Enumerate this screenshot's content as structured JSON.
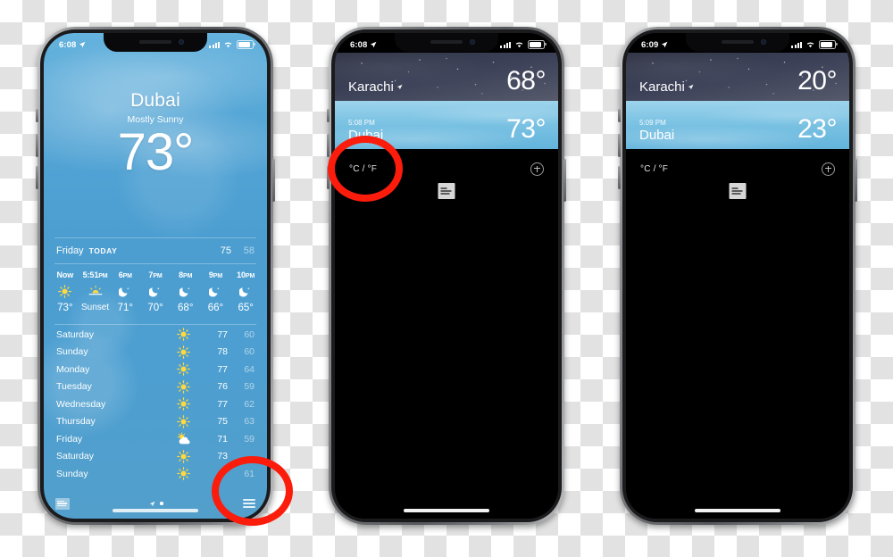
{
  "phone1": {
    "status": {
      "time": "6:08",
      "location_icon": "location-arrow-icon",
      "signal_icon": "signal-bars-icon",
      "wifi_icon": "wifi-icon",
      "battery_icon": "battery-icon"
    },
    "detail": {
      "city": "Dubai",
      "condition": "Mostly Sunny",
      "temperature": "73°"
    },
    "today": {
      "day": "Friday",
      "tag": "TODAY",
      "high": "75",
      "low": "58"
    },
    "hourly": [
      {
        "label": "Now",
        "ampm": "",
        "icon": "sun-icon",
        "value": "73°"
      },
      {
        "label": "5:51",
        "ampm": "PM",
        "icon": "sunset-icon",
        "value": "Sunset"
      },
      {
        "label": "6",
        "ampm": "PM",
        "icon": "moon-icon",
        "value": "71°"
      },
      {
        "label": "7",
        "ampm": "PM",
        "icon": "moon-icon",
        "value": "70°"
      },
      {
        "label": "8",
        "ampm": "PM",
        "icon": "moon-icon",
        "value": "68°"
      },
      {
        "label": "9",
        "ampm": "PM",
        "icon": "moon-icon",
        "value": "66°"
      },
      {
        "label": "10",
        "ampm": "PM",
        "icon": "moon-icon",
        "value": "65°"
      }
    ],
    "daily": [
      {
        "day": "Saturday",
        "icon": "sun-icon",
        "high": "77",
        "low": "60"
      },
      {
        "day": "Sunday",
        "icon": "sun-icon",
        "high": "78",
        "low": "60"
      },
      {
        "day": "Monday",
        "icon": "sun-icon",
        "high": "77",
        "low": "64"
      },
      {
        "day": "Tuesday",
        "icon": "sun-icon",
        "high": "76",
        "low": "59"
      },
      {
        "day": "Wednesday",
        "icon": "sun-icon",
        "high": "77",
        "low": "62"
      },
      {
        "day": "Thursday",
        "icon": "sun-icon",
        "high": "75",
        "low": "63"
      },
      {
        "day": "Friday",
        "icon": "partly-cloudy-icon",
        "high": "71",
        "low": "59"
      },
      {
        "day": "Saturday",
        "icon": "sun-icon",
        "high": "73",
        "low": ""
      },
      {
        "day": "Sunday",
        "icon": "sun-icon",
        "high": "",
        "low": "61"
      }
    ],
    "bottombar": {
      "logo": "weather-channel-logo",
      "location_icon": "location-arrow-icon",
      "page_dot": "page-dot",
      "list_icon": "list-icon"
    }
  },
  "phone2": {
    "status": {
      "time": "6:08"
    },
    "cities": [
      {
        "time": "",
        "name": "Karachi",
        "temp": "68°",
        "mode": "night",
        "has_location_arrow": true
      },
      {
        "time": "5:08 PM",
        "name": "Dubai",
        "temp": "73°",
        "mode": "day",
        "has_location_arrow": false
      }
    ],
    "toolbar": {
      "unit_toggle": "°C / °F",
      "add_icon": "plus-circle-icon"
    },
    "logo": "weather-channel-logo"
  },
  "phone3": {
    "status": {
      "time": "6:09"
    },
    "cities": [
      {
        "time": "",
        "name": "Karachi",
        "temp": "20°",
        "mode": "night",
        "has_location_arrow": true
      },
      {
        "time": "5:09 PM",
        "name": "Dubai",
        "temp": "23°",
        "mode": "day",
        "has_location_arrow": false
      }
    ],
    "toolbar": {
      "unit_toggle": "°C / °F",
      "add_icon": "plus-circle-icon"
    },
    "logo": "weather-channel-logo"
  },
  "annotations": [
    {
      "name": "highlight-list-button",
      "shape": "circle",
      "color": "#fb1c0c"
    },
    {
      "name": "highlight-unit-toggle",
      "shape": "circle",
      "color": "#fb1c0c"
    }
  ]
}
